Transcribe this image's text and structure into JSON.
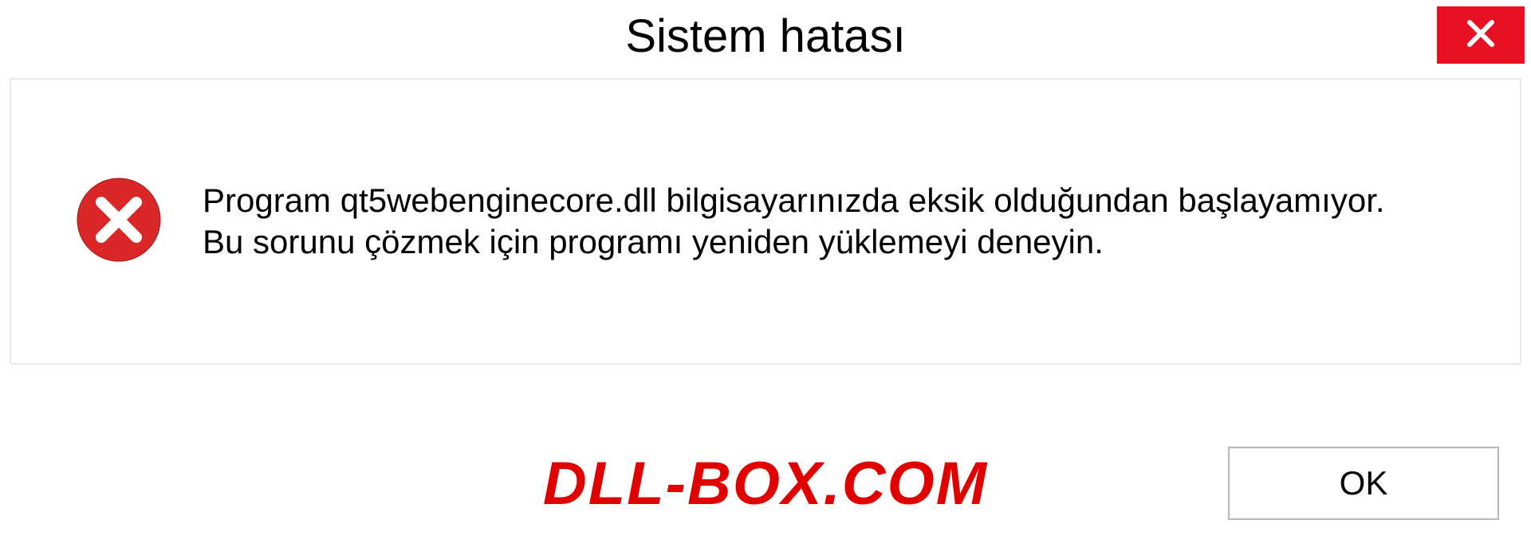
{
  "titlebar": {
    "title": "Sistem hatası"
  },
  "dialog": {
    "message": "Program qt5webenginecore.dll bilgisayarınızda eksik olduğundan başlayamıyor. Bu sorunu çözmek için programı yeniden yüklemeyi deneyin."
  },
  "footer": {
    "watermark": "DLL-BOX.COM",
    "ok_label": "OK"
  },
  "colors": {
    "close_bg": "#e81123",
    "error_icon": "#d92626",
    "watermark_color": "#e10000"
  }
}
